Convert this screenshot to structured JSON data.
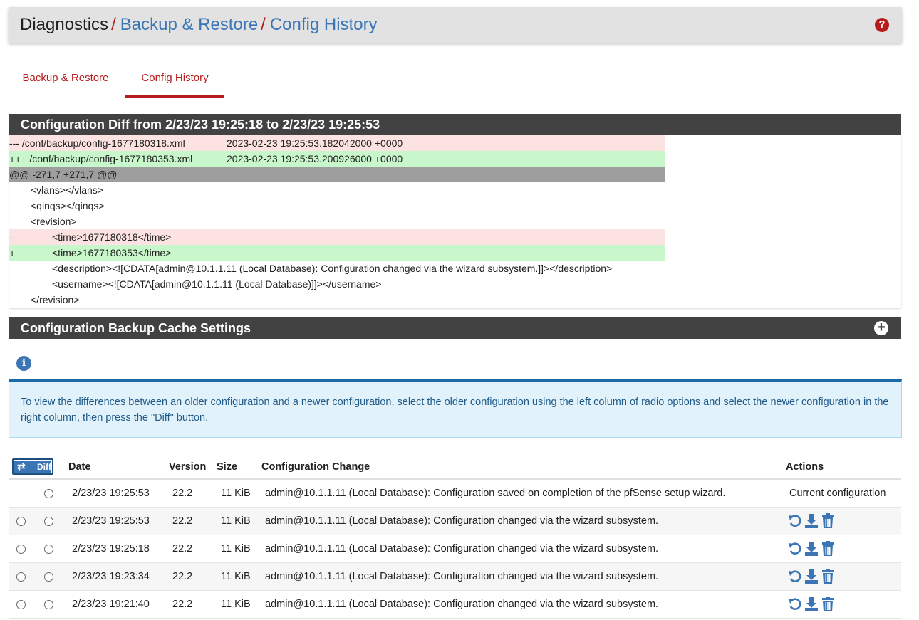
{
  "breadcrumb": {
    "home": "Diagnostics",
    "sep": "/",
    "level1": "Backup & Restore",
    "level2": "Config History"
  },
  "help_icon": "question-circle-icon",
  "tabs": [
    {
      "label": "Backup & Restore",
      "active": false
    },
    {
      "label": "Config History",
      "active": true
    }
  ],
  "diff": {
    "title": "Configuration Diff from 2/23/23 19:25:18 to 2/23/23 19:25:53",
    "old_file": "--- /conf/backup/config-1677180318.xml",
    "old_time": "2023-02-23 19:25:53.182042000 +0000",
    "new_file": "+++ /conf/backup/config-1677180353.xml",
    "new_time": "2023-02-23 19:25:53.200926000 +0000",
    "hunk": "@@ -271,7 +271,7 @@",
    "lines": {
      "l1": "<vlans></vlans>",
      "l2": "<qinqs></qinqs>",
      "l3": "<revision>",
      "del_mark": "-",
      "del_text": "<time>1677180318</time>",
      "add_mark": "+",
      "add_text": "<time>1677180353</time>",
      "l6": "<description><![CDATA[admin@10.1.1.11 (Local Database): Configuration changed via the wizard subsystem.]]></description>",
      "l7": "<username><![CDATA[admin@10.1.1.11 (Local Database)]]></username>",
      "l8": "</revision>"
    }
  },
  "cache": {
    "title": "Configuration Backup Cache Settings",
    "expand_icon": "plus-circle-icon"
  },
  "info": {
    "icon": "info-circle-icon",
    "text": "To view the differences between an older configuration and a newer configuration, select the older configuration using the left column of radio options and select the newer configuration in the right column, then press the \"Diff\" button."
  },
  "table": {
    "diff_button": "Diff",
    "headers": {
      "date": "Date",
      "version": "Version",
      "size": "Size",
      "change": "Configuration Change",
      "actions": "Actions"
    },
    "current_label": "Current configuration",
    "rows": [
      {
        "date": "2/23/23 19:25:53",
        "version": "22.2",
        "size": "11 KiB",
        "change": "admin@10.1.1.11 (Local Database): Configuration saved on completion of the pfSense setup wizard.",
        "current": true
      },
      {
        "date": "2/23/23 19:25:53",
        "version": "22.2",
        "size": "11 KiB",
        "change": "admin@10.1.1.11 (Local Database): Configuration changed via the wizard subsystem.",
        "current": false
      },
      {
        "date": "2/23/23 19:25:18",
        "version": "22.2",
        "size": "11 KiB",
        "change": "admin@10.1.1.11 (Local Database): Configuration changed via the wizard subsystem.",
        "current": false
      },
      {
        "date": "2/23/23 19:23:34",
        "version": "22.2",
        "size": "11 KiB",
        "change": "admin@10.1.1.11 (Local Database): Configuration changed via the wizard subsystem.",
        "current": false
      },
      {
        "date": "2/23/23 19:21:40",
        "version": "22.2",
        "size": "11 KiB",
        "change": "admin@10.1.1.11 (Local Database): Configuration changed via the wizard subsystem.",
        "current": false
      }
    ]
  },
  "colors": {
    "accent_red": "#b71c1c",
    "link_blue": "#3b75b5",
    "panel_dark": "#424242",
    "diff_del": "#fde2e2",
    "diff_add": "#c8f7cc",
    "info_bg": "#e1f2fb"
  }
}
